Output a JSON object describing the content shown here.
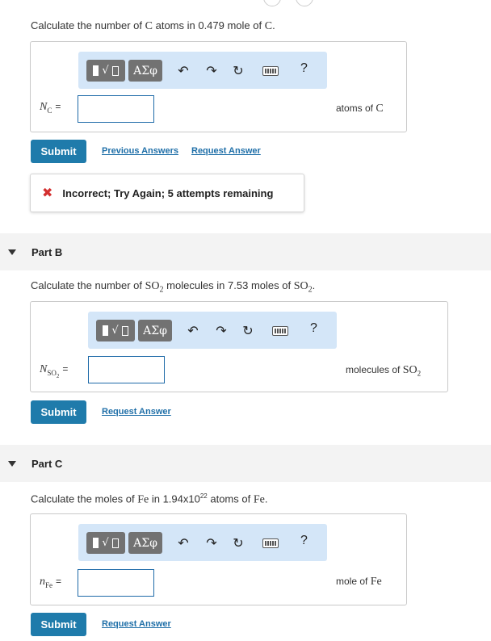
{
  "part_a": {
    "prompt_pre": "Calculate the number of ",
    "prompt_sym": "C",
    "prompt_mid": " atoms in 0.479 mole of ",
    "prompt_sym2": "C",
    "prompt_end": ".",
    "var_main": "N",
    "var_sub": "C",
    "equals": "=",
    "unit_text": "atoms of ",
    "unit_sym": "C",
    "submit_label": "Submit",
    "previous_answers": "Previous Answers",
    "request_answer": "Request Answer",
    "feedback": "Incorrect; Try Again; 5 attempts remaining"
  },
  "part_b": {
    "title": "Part B",
    "prompt_pre": "Calculate the number of ",
    "prompt_sym": "SO",
    "prompt_sub": "2",
    "prompt_mid": " molecules in 7.53 moles of ",
    "prompt_sym2": "SO",
    "prompt_sub2": "2",
    "prompt_end": ".",
    "var_main": "N",
    "var_sub": "SO",
    "var_subsub": "2",
    "equals": "=",
    "unit_text": "molecules of ",
    "unit_sym": "SO",
    "unit_sub": "2",
    "submit_label": "Submit",
    "request_answer": "Request Answer"
  },
  "part_c": {
    "title": "Part C",
    "prompt_pre": "Calculate the moles of ",
    "prompt_sym": "Fe",
    "prompt_mid": " in 1.94x10",
    "prompt_exp": "22",
    "prompt_mid2": " atoms of ",
    "prompt_sym2": "Fe",
    "prompt_end": ".",
    "var_main": "n",
    "var_sub": "Fe",
    "equals": "=",
    "unit_text": "mole of ",
    "unit_sym": "Fe",
    "submit_label": "Submit",
    "request_answer": "Request Answer"
  },
  "toolbar": {
    "greek_label": "ΑΣφ",
    "help_label": "?",
    "icons": [
      "templates-icon",
      "greek-symbols-icon",
      "undo-icon",
      "redo-icon",
      "reset-icon",
      "keyboard-icon",
      "help-icon"
    ]
  },
  "colors": {
    "submit_bg": "#1f7bab",
    "toolbar_bg": "#d4e6f8",
    "link": "#1f6fa8",
    "error_x": "#d32f2f",
    "part_header_bg": "#f3f3f3"
  }
}
